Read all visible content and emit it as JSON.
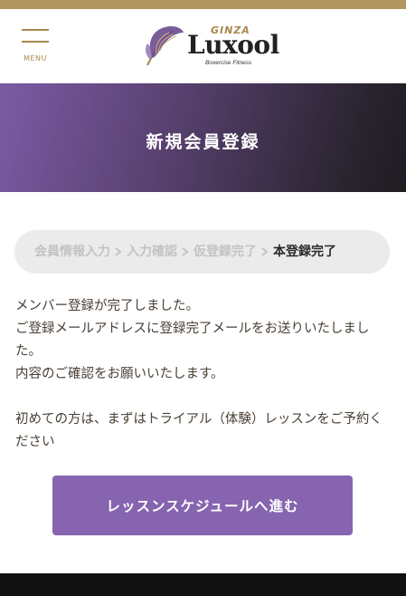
{
  "header": {
    "menu_label": "MENU",
    "logo": {
      "small": "GINZA",
      "brand": "Luxool",
      "tagline": "Boxercise Fitness"
    }
  },
  "hero": {
    "title": "新規会員登録"
  },
  "steps": [
    {
      "label": "会員情報入力",
      "state": "done"
    },
    {
      "label": "入力確認",
      "state": "done"
    },
    {
      "label": "仮登録完了",
      "state": "done"
    },
    {
      "label": "本登録完了",
      "state": "current"
    }
  ],
  "message": {
    "line1": "メンバー登録が完了しました。",
    "line2": "ご登録メールアドレスに登録完了メールをお送りいたしました。",
    "line3": "内容のご確認をお願いいたします。",
    "line4": "初めての方は、まずはトライアル（体験）レッスンをご予約ください"
  },
  "cta": {
    "label": "レッスンスケジュールへ進む"
  },
  "colors": {
    "gold": "#b29660",
    "purple_button": "#8664b0",
    "hero_start": "#7c5aa5",
    "hero_end": "#1f1c22"
  },
  "icons": [
    "hamburger-menu-icon",
    "butterfly-logo-icon",
    "chevron-right-icon"
  ]
}
